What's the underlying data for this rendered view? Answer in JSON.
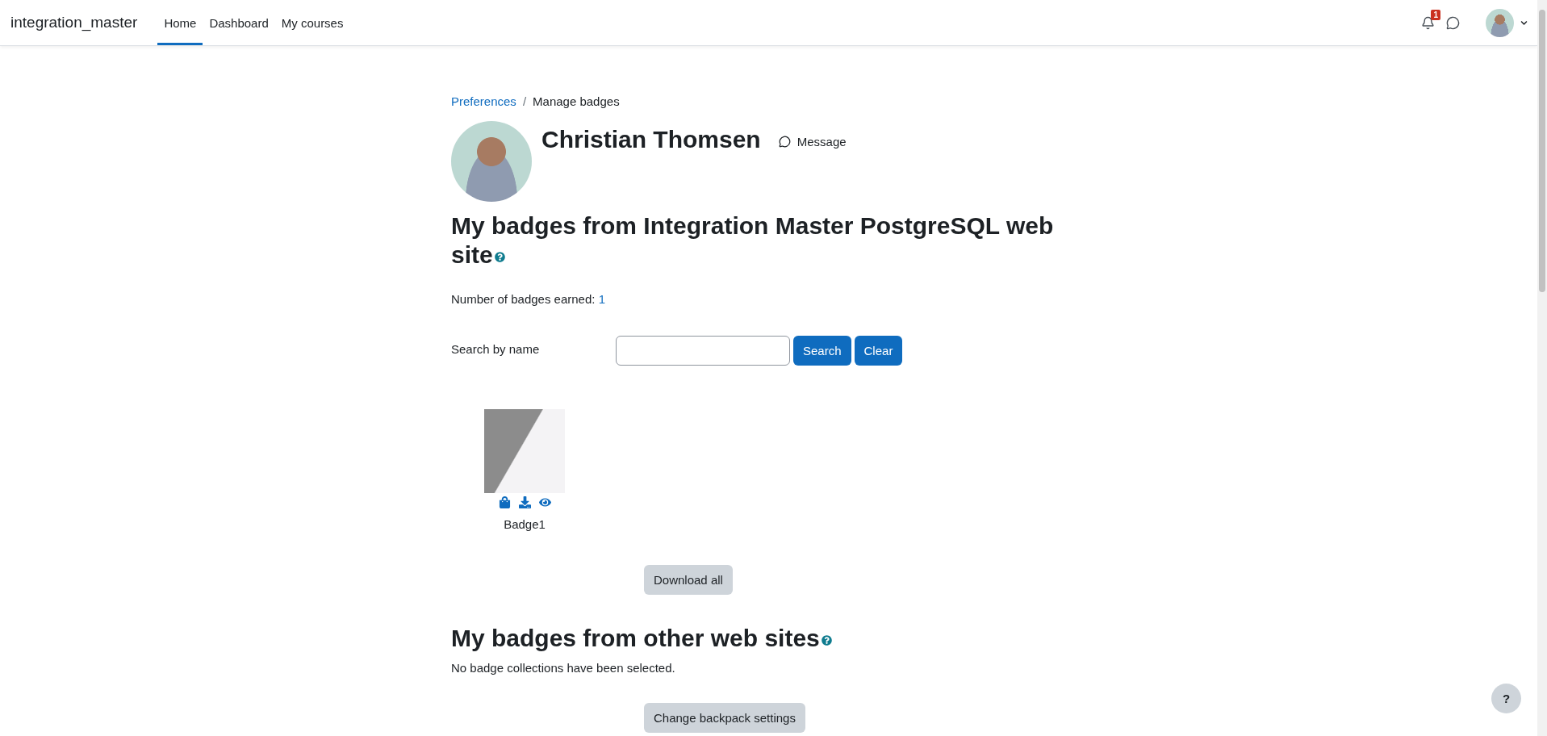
{
  "navbar": {
    "brand": "integration_master",
    "items": [
      {
        "label": "Home",
        "selected": true
      },
      {
        "label": "Dashboard",
        "selected": false
      },
      {
        "label": "My courses",
        "selected": false
      }
    ],
    "notification_count": "1"
  },
  "breadcrumb_separator": "/",
  "breadcrumb": [
    {
      "label": "Preferences",
      "kind": "link"
    },
    {
      "label": "Manage badges",
      "kind": "current"
    }
  ],
  "profile": {
    "name": "Christian Thomsen",
    "message": "Message"
  },
  "site_badges": {
    "title": "My badges from Integration Master PostgreSQL web site",
    "earned_label": "Number of badges earned:",
    "earned_count": "1",
    "search_label": "Search by name",
    "buttons": [
      "Search",
      "Clear"
    ],
    "badges": [
      {
        "name": "Badge1"
      }
    ],
    "download_all": "Download all"
  },
  "other_badges": {
    "title": "My badges from other web sites",
    "message": "No badge collections have been selected.",
    "button": "Change backpack settings"
  },
  "help_button": "?"
}
